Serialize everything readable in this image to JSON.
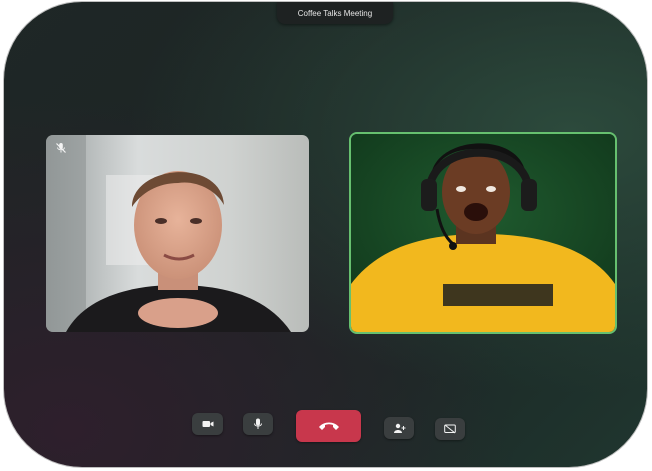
{
  "meeting": {
    "title": "Coffee Talks Meeting"
  },
  "participants": [
    {
      "video": "left-participant-video",
      "muted": true,
      "muted_icon": "mic-off-icon"
    },
    {
      "video": "right-participant-video",
      "active_speaker": true,
      "highlight_color": "#66c06f"
    }
  ],
  "controls": {
    "camera_icon": "video-camera-icon",
    "mic_icon": "microphone-icon",
    "end_call_icon": "phone-hangup-icon",
    "end_call_color": "#c8374c",
    "add_person_icon": "add-person-icon",
    "screen_share_icon": "screen-share-off-icon"
  },
  "colors": {
    "background": "#1c2424",
    "control_bg": "#3a3e3f",
    "active_border": "#66c06f"
  }
}
